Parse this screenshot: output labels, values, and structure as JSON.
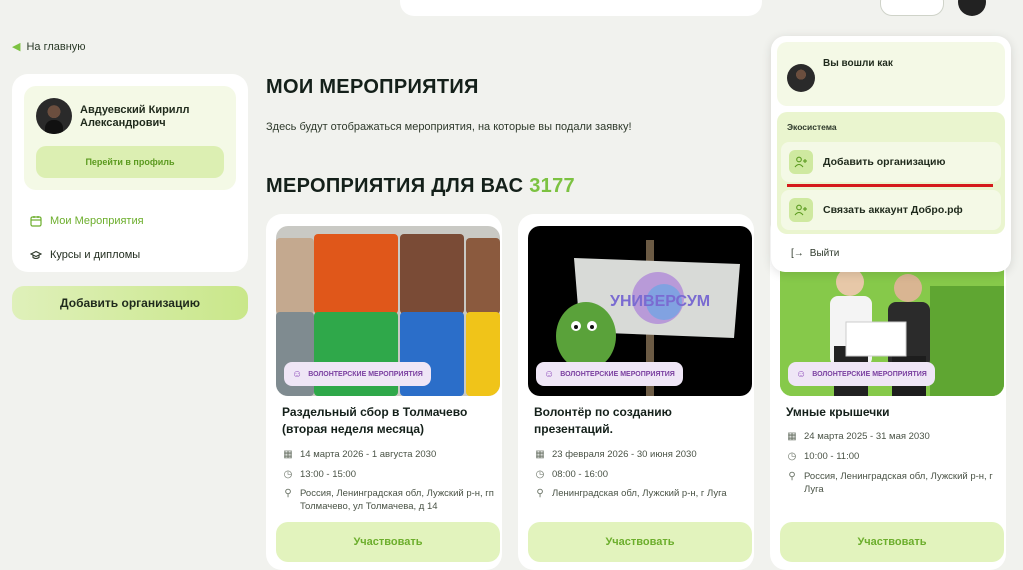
{
  "nav": {
    "back_label": "На главную"
  },
  "profile": {
    "name": "Авдуевский Кирилл Александрович",
    "profile_button": "Перейти в профиль",
    "menu": [
      {
        "label": "Мои Мероприятия",
        "icon": "calendar-icon",
        "active": true
      },
      {
        "label": "Курсы и дипломы",
        "icon": "graduation-cap-icon",
        "active": false
      }
    ],
    "add_org_button": "Добавить организацию"
  },
  "main": {
    "title": "МОИ МЕРОПРИЯТИЯ",
    "subtitle": "Здесь будут отображаться мероприятия, на которые вы подали заявку!",
    "section_title": "МЕРОПРИЯТИЯ ДЛЯ ВАС",
    "section_count": "3177"
  },
  "events": [
    {
      "badge": "ВОЛОНТЕРСКИЕ МЕРОПРИЯТИЯ",
      "title": "Раздельный сбор в Толмачево (вторая неделя месяца)",
      "dates": "14 марта 2026 - 1 августа 2030",
      "time": "13:00 - 15:00",
      "location": "Россия, Ленинградская обл, Лужский р-н, гп Толмачево, ул Толмачева, д 14",
      "button": "Участвовать"
    },
    {
      "badge": "ВОЛОНТЕРСКИЕ МЕРОПРИЯТИЯ",
      "title": "Волонтёр по созданию презентаций.",
      "dates": "23 февраля 2026 - 30 июня 2030",
      "time": "08:00 - 16:00",
      "location": "Ленинградская обл, Лужский р-н, г Луга",
      "image_text": "УНИВЕРСУМ",
      "button": "Участвовать"
    },
    {
      "badge": "ВОЛОНТЕРСКИЕ МЕРОПРИЯТИЯ",
      "title": "Умные крышечки",
      "dates": "24 марта 2025 - 31 мая 2030",
      "time": "10:00 - 11:00",
      "location": "Россия, Ленинградская обл, Лужский р-н, г Луга",
      "button": "Участвовать"
    }
  ],
  "dropdown": {
    "logged_in_label": "Вы вошли как",
    "ecosystem_label": "Экосистема",
    "add_org": "Добавить организацию",
    "link_account": "Связать аккаунт Добро.рф",
    "logout": "Выйти"
  },
  "colors": {
    "accent": "#7cc241",
    "accent_light": "#e2f3bd",
    "badge_bg": "#efe6f6",
    "badge_text": "#7a3fa0",
    "highlight": "#d41a1a"
  }
}
